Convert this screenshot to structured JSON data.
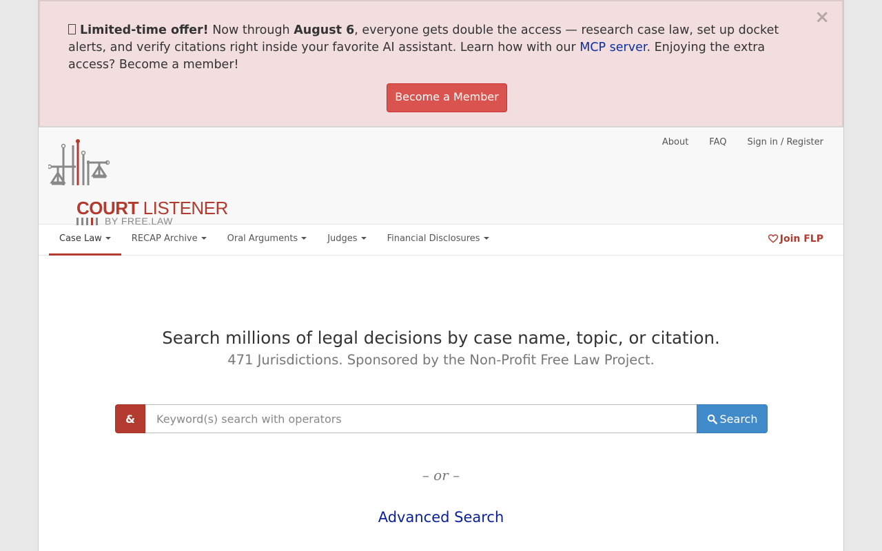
{
  "banner": {
    "lead": "Limited-time offer!",
    "text1": " Now through ",
    "date": "August 6",
    "text2": ", everyone gets double the access — research case law, set up docket alerts, and verify citations right inside your favorite AI assistant. Learn how with our ",
    "link": "MCP server",
    "text3": ". Enjoying the extra access? Become a member!",
    "close": "×",
    "button": "Become a Member"
  },
  "logo": {
    "court": "COURT",
    "listener": " LISTENER",
    "sub": "BY FREE.LAW"
  },
  "top_links": [
    "About",
    "FAQ",
    "Sign in / Register"
  ],
  "nav": {
    "items": [
      "Case Law",
      "RECAP Archive",
      "Oral Arguments",
      "Judges",
      "Financial Disclosures"
    ],
    "join": "Join FLP"
  },
  "hero": {
    "title": "Search millions of legal decisions by case name, topic, or citation.",
    "subtitle": "471 Jurisdictions. Sponsored by the Non-Profit Free Law Project."
  },
  "search": {
    "operator": "&",
    "placeholder": "Keyword(s) search with operators",
    "value": "",
    "button": "Search"
  },
  "or": "– or –",
  "advanced": "Advanced Search",
  "colors": {
    "brand": "#b23a2f",
    "primary": "#428bca",
    "danger": "#d9534f",
    "banner_bg": "#f2dede"
  }
}
